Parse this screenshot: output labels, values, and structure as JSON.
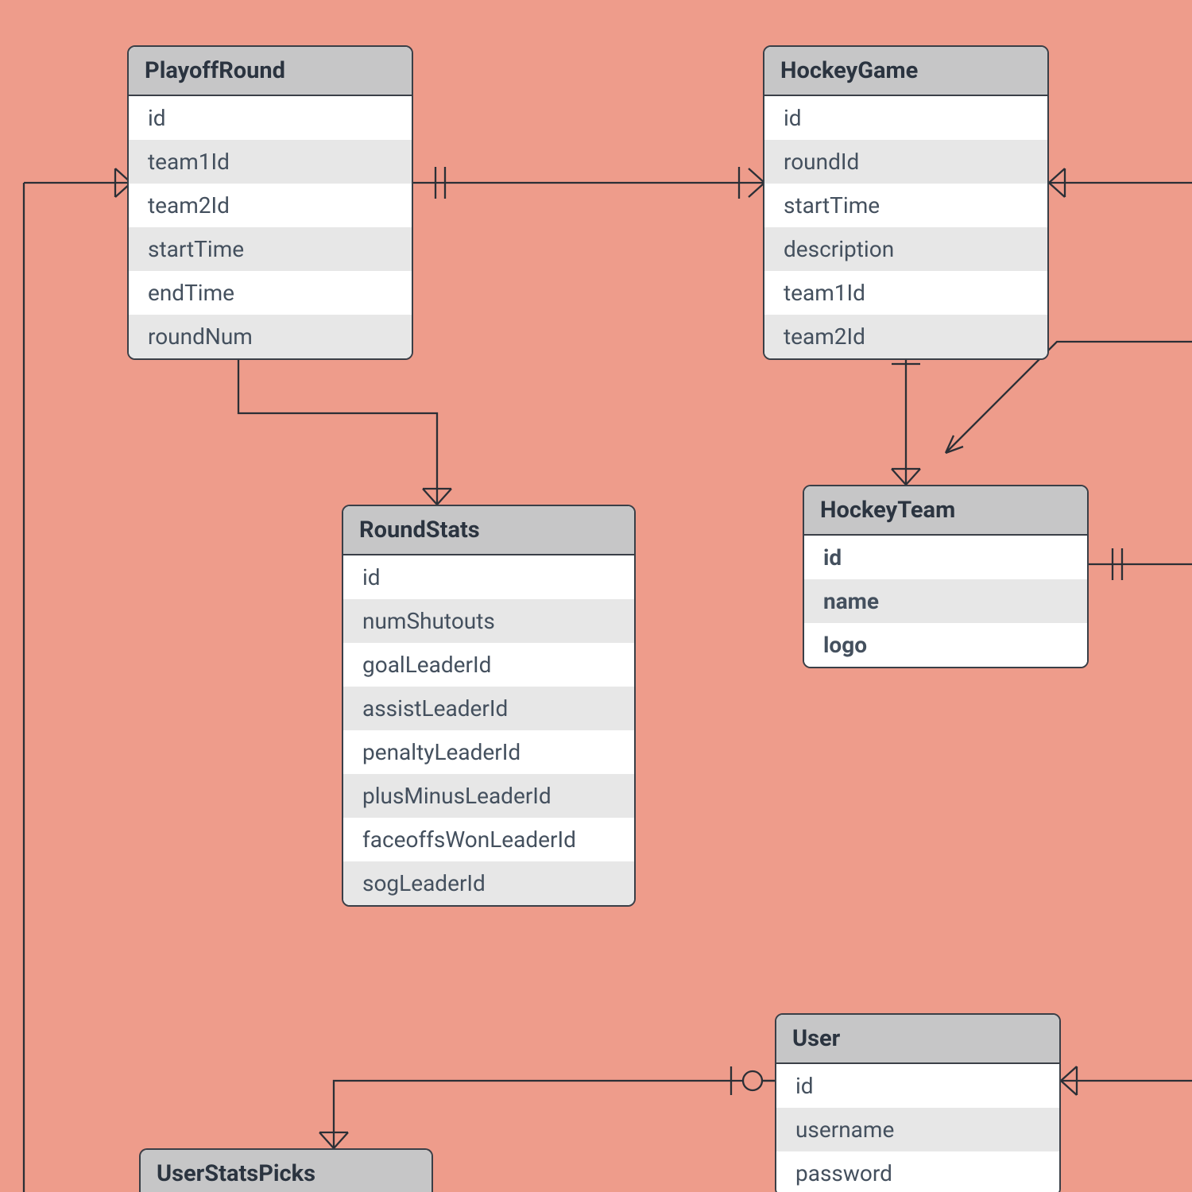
{
  "entities": {
    "playoffRound": {
      "title": "PlayoffRound",
      "fields": [
        "id",
        "team1Id",
        "team2Id",
        "startTime",
        "endTime",
        "roundNum"
      ]
    },
    "hockeyGame": {
      "title": "HockeyGame",
      "fields": [
        "id",
        "roundId",
        "startTime",
        "description",
        "team1Id",
        "team2Id"
      ]
    },
    "roundStats": {
      "title": "RoundStats",
      "fields": [
        "id",
        "numShutouts",
        "goalLeaderId",
        "assistLeaderId",
        "penaltyLeaderId",
        "plusMinusLeaderId",
        "faceoffsWonLeaderId",
        "sogLeaderId"
      ]
    },
    "hockeyTeam": {
      "title": "HockeyTeam",
      "fields": [
        "id",
        "name",
        "logo"
      ]
    },
    "user": {
      "title": "User",
      "fields": [
        "id",
        "username",
        "password"
      ]
    },
    "userStatsPicks": {
      "title": "UserStatsPicks"
    }
  }
}
